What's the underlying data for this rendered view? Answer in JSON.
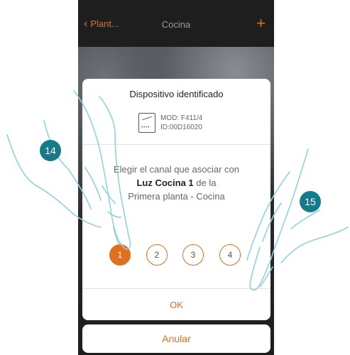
{
  "appbar": {
    "back_label": "Plant...",
    "title": "Cocina",
    "add_symbol": "+"
  },
  "dialog": {
    "title": "Dispositivo identificado",
    "device": {
      "model": "MOD: F411/4",
      "id": "ID:00D16020",
      "icon": "switch-device-icon"
    },
    "message": {
      "prefix": "Elegir el canal que asociar con",
      "device_name": "Luz Cocina 1",
      "suffix": "de la",
      "location": "Primera planta - Cocina"
    },
    "channels": [
      "1",
      "2",
      "3",
      "4"
    ],
    "selected_channel": "1",
    "ok_label": "OK"
  },
  "cancel_label": "Anular",
  "steps": [
    "14",
    "15"
  ],
  "colors": {
    "accent": "#e0701e",
    "step_badge": "#157b8a",
    "app_background": "#1b1b1b"
  }
}
